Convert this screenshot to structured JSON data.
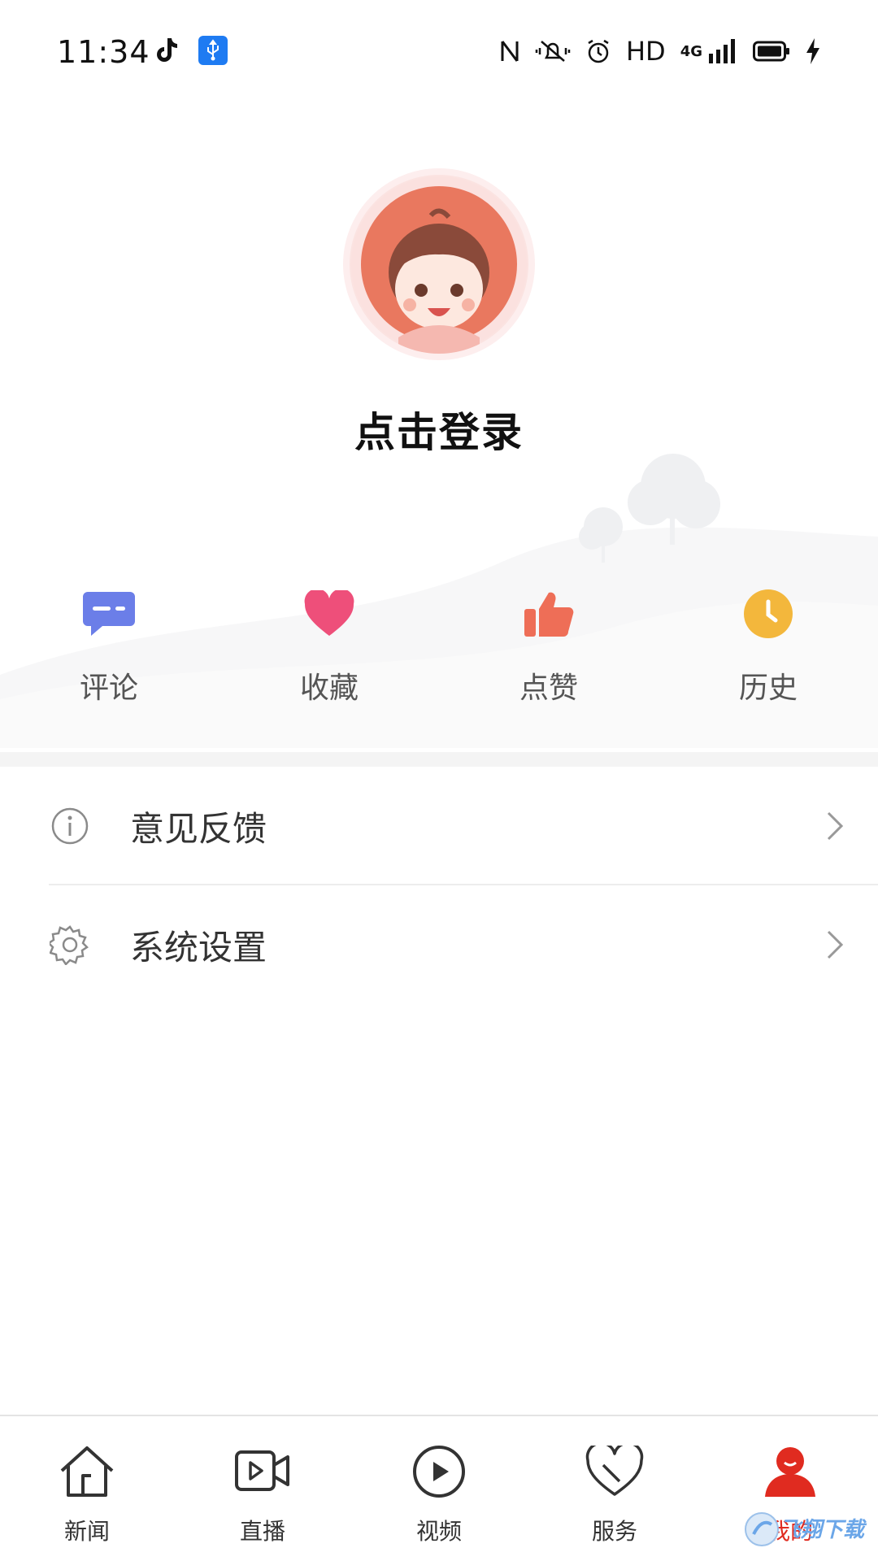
{
  "status_bar": {
    "time": "11:34",
    "network_hd": "HD",
    "network_type": "4G",
    "icons": [
      "tiktok-icon",
      "usb-icon",
      "nfc-icon",
      "vibrate-mute-icon",
      "alarm-icon",
      "signal-icon",
      "battery-icon",
      "charging-icon"
    ]
  },
  "profile": {
    "login_label": "点击登录"
  },
  "quick_actions": [
    {
      "label": "评论",
      "icon": "comment-icon",
      "color": "#6b7ee8"
    },
    {
      "label": "收藏",
      "icon": "heart-icon",
      "color": "#ee4f7a"
    },
    {
      "label": "点赞",
      "icon": "thumbs-up-icon",
      "color": "#ee6e57"
    },
    {
      "label": "历史",
      "icon": "clock-icon",
      "color": "#f3b73c"
    }
  ],
  "menu": [
    {
      "label": "意见反馈",
      "icon": "info-icon"
    },
    {
      "label": "系统设置",
      "icon": "gear-icon"
    }
  ],
  "bottom_nav": {
    "active_color": "#e02b20",
    "tabs": [
      {
        "label": "新闻",
        "icon": "home-icon",
        "active": false
      },
      {
        "label": "直播",
        "icon": "video-camera-icon",
        "active": false
      },
      {
        "label": "视频",
        "icon": "play-circle-icon",
        "active": false
      },
      {
        "label": "服务",
        "icon": "heart-outline-icon",
        "active": false
      },
      {
        "label": "我的",
        "icon": "user-icon",
        "active": true
      }
    ]
  },
  "watermark": {
    "text": "飞翔下载"
  }
}
